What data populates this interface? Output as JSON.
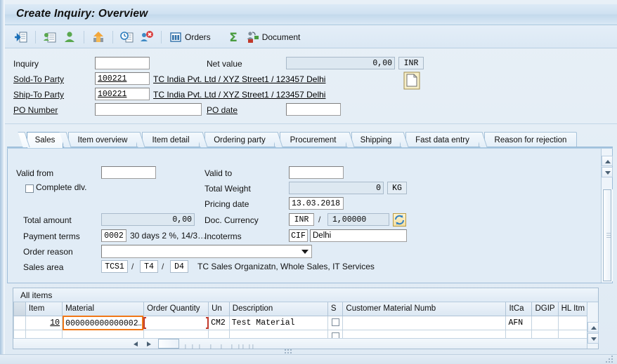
{
  "window": {
    "title": "Create Inquiry: Overview"
  },
  "toolbar": {
    "buttons": [
      {
        "name": "enter-icon",
        "label": ""
      },
      {
        "name": "sales-doc-icon",
        "label": ""
      },
      {
        "name": "partner-icon",
        "label": ""
      },
      {
        "name": "shipping-icon",
        "label": ""
      },
      {
        "name": "availability-icon",
        "label": ""
      },
      {
        "name": "reject-icon",
        "label": ""
      },
      {
        "name": "orders-icon",
        "label": "Orders"
      },
      {
        "name": "sum-icon",
        "label": ""
      },
      {
        "name": "document-icon",
        "label": "Document"
      }
    ],
    "orders_label": "Orders",
    "document_label": "Document"
  },
  "header": {
    "inquiry": {
      "label": "Inquiry",
      "value": ""
    },
    "net_value": {
      "label": "Net value",
      "value": "0,00",
      "currency": "INR"
    },
    "sold_to_party": {
      "label": "Sold-To Party",
      "value": "100221",
      "description": "TC India Pvt. Ltd / XYZ Street1 / 123457 Delhi"
    },
    "ship_to_party": {
      "label": "Ship-To Party",
      "value": "100221",
      "description": "TC India Pvt. Ltd / XYZ Street1 / 123457 Delhi"
    },
    "po_number": {
      "label": "PO Number",
      "value": ""
    },
    "po_date": {
      "label": "PO date",
      "value": ""
    },
    "icons": [
      {
        "name": "document-page-icon"
      },
      {
        "name": "search-document-icon"
      }
    ]
  },
  "tabs": {
    "active_index": 0,
    "items": [
      {
        "label": "Sales"
      },
      {
        "label": "Item overview"
      },
      {
        "label": "Item detail"
      },
      {
        "label": "Ordering party"
      },
      {
        "label": "Procurement"
      },
      {
        "label": "Shipping"
      },
      {
        "label": "Fast data entry"
      },
      {
        "label": "Reason for rejection"
      }
    ]
  },
  "sales": {
    "valid_from": {
      "label": "Valid from",
      "value": ""
    },
    "valid_to": {
      "label": "Valid to",
      "value": ""
    },
    "complete_dlv": {
      "label": "Complete dlv.",
      "checked": false
    },
    "total_weight": {
      "label": "Total Weight",
      "value": "0",
      "unit": "KG"
    },
    "pricing_date": {
      "label": "Pricing date",
      "value": "13.03.2018"
    },
    "total_amount": {
      "label": "Total amount",
      "value": "0,00"
    },
    "doc_currency": {
      "label": "Doc. Currency",
      "value": "INR",
      "separator": "/",
      "rate": "1,00000"
    },
    "payment_terms": {
      "label": "Payment terms",
      "key": "0002",
      "text": "30 days 2 %, 14/3…"
    },
    "incoterms": {
      "label": "Incoterms",
      "key": "CIF",
      "text": "Delhi"
    },
    "order_reason": {
      "label": "Order reason",
      "value": ""
    },
    "sales_area": {
      "label": "Sales area",
      "org": "TCS1",
      "sep1": "/",
      "channel": "T4",
      "sep2": "/",
      "division": "D4",
      "text": "TC Sales Organizatn, Whole Sales, IT Services"
    },
    "refresh_icon": "exchange-rate-refresh-icon"
  },
  "items": {
    "title": "All items",
    "columns": [
      {
        "label": ""
      },
      {
        "label": "Item"
      },
      {
        "label": "Material"
      },
      {
        "label": "Order Quantity"
      },
      {
        "label": "Un"
      },
      {
        "label": "Description"
      },
      {
        "label": "S"
      },
      {
        "label": "Customer Material Numb"
      },
      {
        "label": "ItCa"
      },
      {
        "label": "DGIP"
      },
      {
        "label": "HL Itm"
      },
      {
        "label": ""
      }
    ],
    "rows": [
      {
        "item": "10",
        "material": "000000000000002…",
        "order_quantity": "",
        "un": "CM2",
        "description": "Test Material",
        "s_checked": false,
        "customer_material": "",
        "itca": "AFN",
        "dgip": "",
        "hl_itm": ""
      },
      {
        "item": "",
        "material": "",
        "order_quantity": "",
        "un": "",
        "description": "",
        "s_checked": false,
        "customer_material": "",
        "itca": "",
        "dgip": "",
        "hl_itm": ""
      }
    ]
  },
  "colors": {
    "focus_orange": "#f07818",
    "input_yellow": "#fbedbe",
    "panel_bg": "#e1ecf6",
    "accent_blue": "#a9c5dd"
  }
}
